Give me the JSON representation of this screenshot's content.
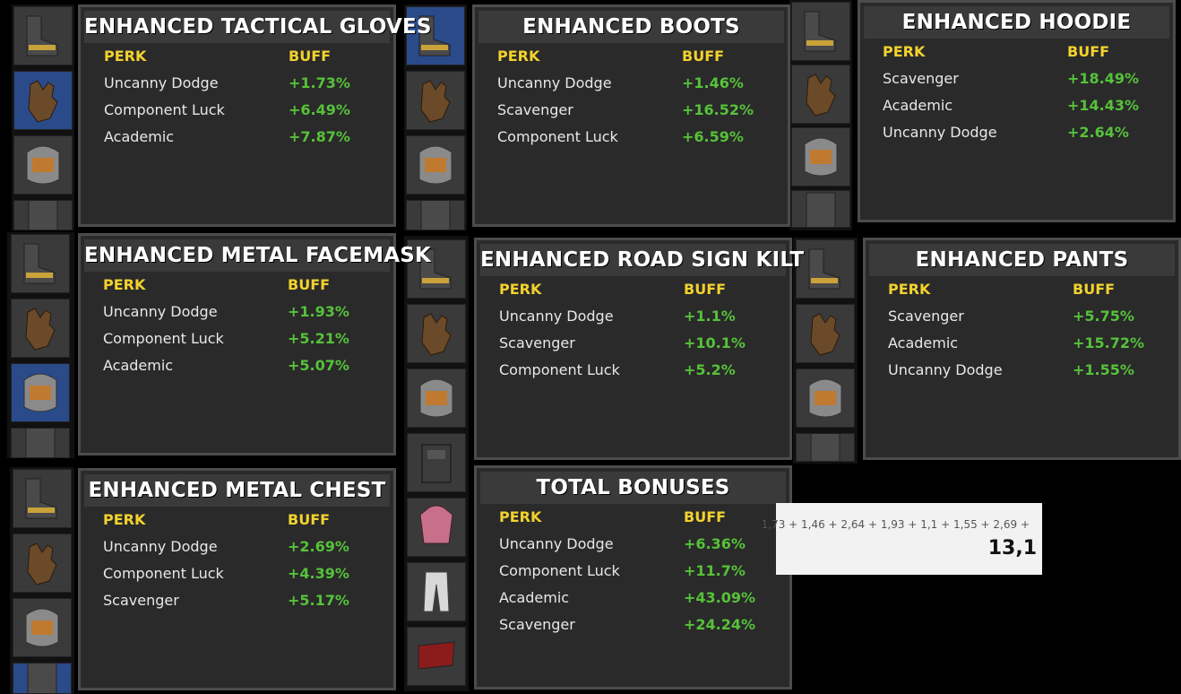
{
  "colors": {
    "perk_header": "#f2d22e",
    "buff": "#56c23a",
    "title": "#ffffff",
    "panel_bg": "#2a2a2a"
  },
  "header_labels": {
    "perk": "PERK",
    "buff": "BUFF"
  },
  "panels": [
    {
      "title": "ENHANCED TACTICAL GLOVES",
      "rows": [
        {
          "perk": "Uncanny Dodge",
          "buff": "+1.73%"
        },
        {
          "perk": "Component Luck",
          "buff": "+6.49%"
        },
        {
          "perk": "Academic",
          "buff": "+7.87%"
        }
      ]
    },
    {
      "title": "ENHANCED BOOTS",
      "rows": [
        {
          "perk": "Uncanny Dodge",
          "buff": "+1.46%"
        },
        {
          "perk": "Scavenger",
          "buff": "+16.52%"
        },
        {
          "perk": "Component Luck",
          "buff": "+6.59%"
        }
      ]
    },
    {
      "title": "ENHANCED HOODIE",
      "rows": [
        {
          "perk": "Scavenger",
          "buff": "+18.49%"
        },
        {
          "perk": "Academic",
          "buff": "+14.43%"
        },
        {
          "perk": "Uncanny Dodge",
          "buff": "+2.64%"
        }
      ]
    },
    {
      "title": "ENHANCED METAL FACEMASK",
      "rows": [
        {
          "perk": "Uncanny Dodge",
          "buff": "+1.93%"
        },
        {
          "perk": "Component Luck",
          "buff": "+5.21%"
        },
        {
          "perk": "Academic",
          "buff": "+5.07%"
        }
      ]
    },
    {
      "title": "ENHANCED ROAD SIGN KILT",
      "rows": [
        {
          "perk": "Uncanny Dodge",
          "buff": "+1.1%"
        },
        {
          "perk": "Scavenger",
          "buff": "+10.1%"
        },
        {
          "perk": "Component Luck",
          "buff": "+5.2%"
        }
      ]
    },
    {
      "title": "ENHANCED PANTS",
      "rows": [
        {
          "perk": "Scavenger",
          "buff": "+5.75%"
        },
        {
          "perk": "Academic",
          "buff": "+15.72%"
        },
        {
          "perk": "Uncanny Dodge",
          "buff": "+1.55%"
        }
      ]
    },
    {
      "title": "ENHANCED METAL CHEST",
      "rows": [
        {
          "perk": "Uncanny Dodge",
          "buff": "+2.69%"
        },
        {
          "perk": "Component Luck",
          "buff": "+4.39%"
        },
        {
          "perk": "Scavenger",
          "buff": "+5.17%"
        }
      ]
    },
    {
      "title": "TOTAL BONUSES",
      "rows": [
        {
          "perk": "Uncanny Dodge",
          "buff": "+6.36%"
        },
        {
          "perk": "Component Luck",
          "buff": "+11.7%"
        },
        {
          "perk": "Academic",
          "buff": "+43.09%"
        },
        {
          "perk": "Scavenger",
          "buff": "+24.24%"
        }
      ]
    }
  ],
  "calculator": {
    "expression": "1,73 + 1,46 + 2,64 + 1,93 + 1,1 + 1,55 + 2,69 +",
    "result": "13,1"
  },
  "item_icons": [
    "boots-icon",
    "gloves-icon",
    "facemask-icon",
    "chestplate-icon",
    "hoodie-icon",
    "pants-icon",
    "kilt-icon"
  ]
}
